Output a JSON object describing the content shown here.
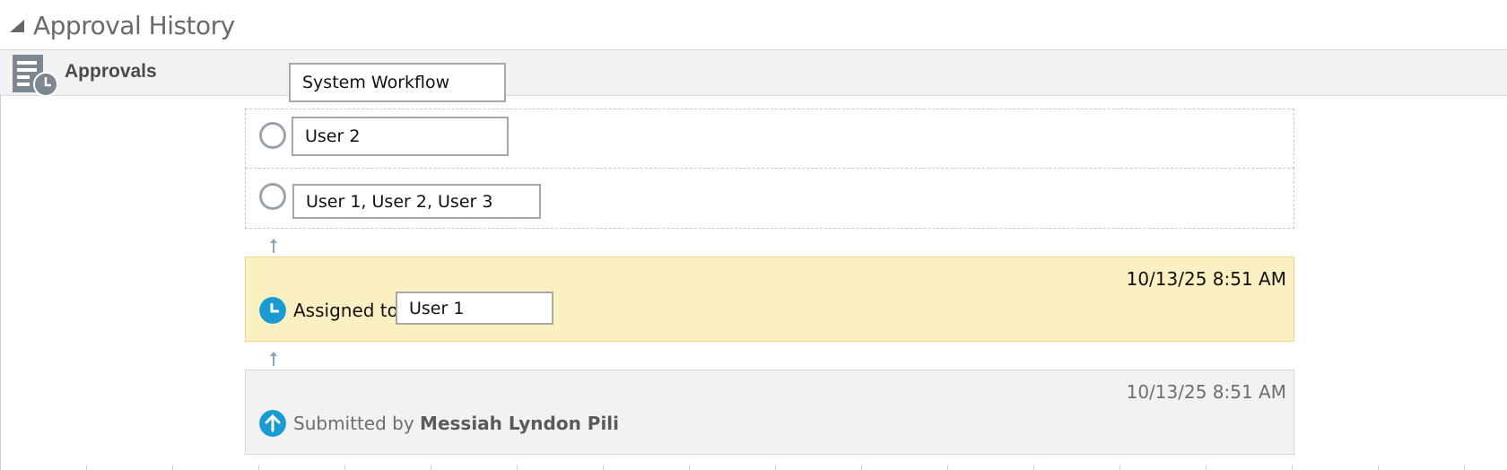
{
  "section": {
    "title": "Approval History"
  },
  "approvals": {
    "title": "Approvals",
    "workflow_label": "System Workflow"
  },
  "future_steps": [
    {
      "assignees": "User 2"
    },
    {
      "assignees": "User 1, User 2, User 3"
    }
  ],
  "assigned": {
    "timestamp": "10/13/25 8:51 AM",
    "label": "Assigned to",
    "assignee": "User 1"
  },
  "submitted": {
    "timestamp": "10/13/25 8:51 AM",
    "label": "Submitted by",
    "submitter": "Messiah Lyndon Pili"
  },
  "colors": {
    "assigned_bg": "#fbf0c2",
    "submitted_bg": "#f2f2f2",
    "status_blue": "#1a9bd1"
  },
  "icons": {
    "collapse": "triangle-collapse-icon",
    "approvals": "document-clock-icon",
    "pending": "empty-circle-icon",
    "assigned": "clock-icon",
    "submitted": "up-arrow-icon",
    "connector": "small-up-arrow-icon"
  }
}
